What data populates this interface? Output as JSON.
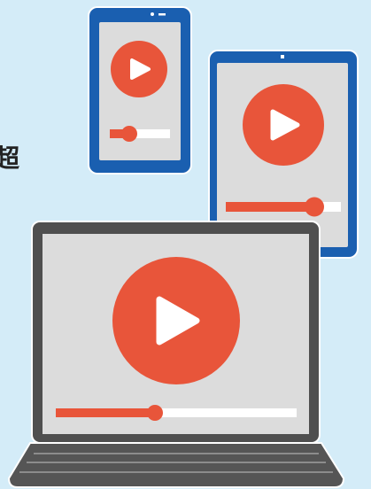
{
  "edge_text": "超",
  "colors": {
    "background": "#d4ecf8",
    "device_frame_blue": "#1a5fb0",
    "screen_gray": "#dcdcdc",
    "play_orange": "#e8553a",
    "laptop_frame": "#4f4f4f",
    "laptop_base": "#555555"
  },
  "devices": [
    {
      "name": "smartphone",
      "icon": "play-icon",
      "progress": 0.25
    },
    {
      "name": "tablet",
      "icon": "play-icon",
      "progress": 0.77
    },
    {
      "name": "laptop",
      "icon": "play-icon",
      "progress": 0.41
    }
  ]
}
